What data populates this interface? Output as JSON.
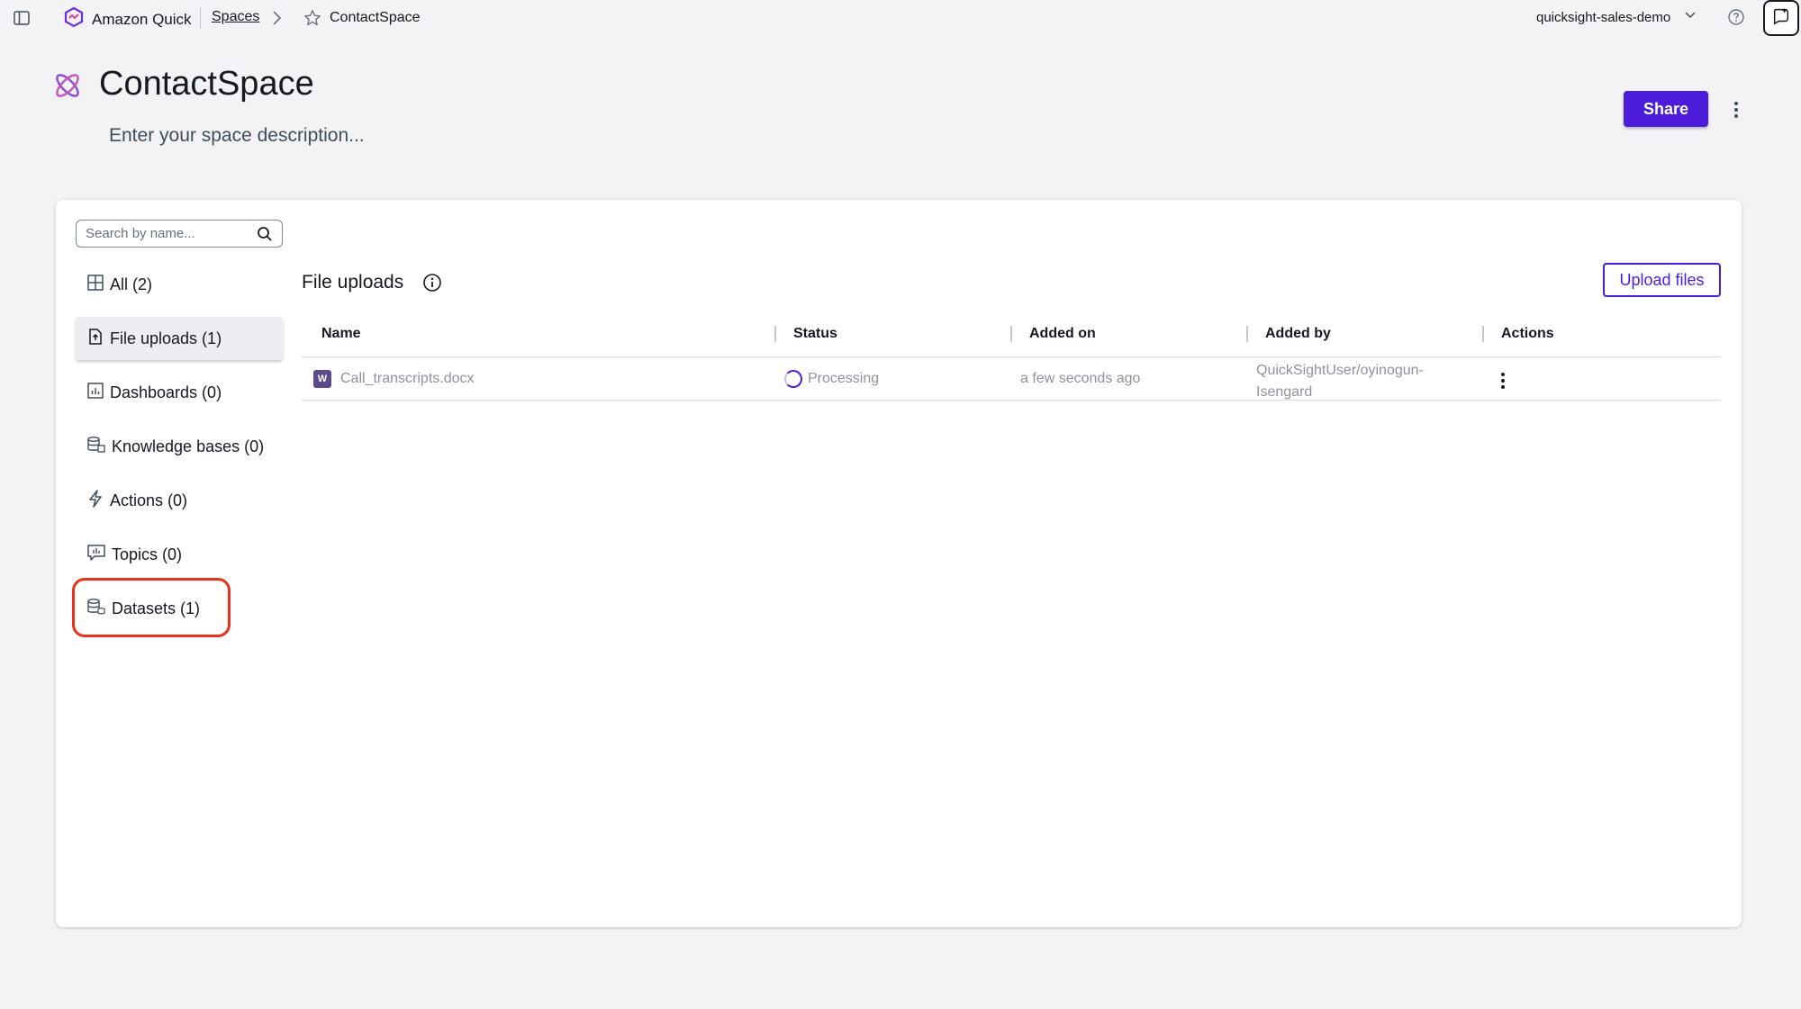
{
  "topbar": {
    "brand_name": "Amazon Quick",
    "breadcrumb_spaces": "Spaces",
    "breadcrumb_current": "ContactSpace",
    "account_name": "quicksight-sales-demo"
  },
  "header": {
    "title": "ContactSpace",
    "description_placeholder": "Enter your space description...",
    "share_label": "Share"
  },
  "sidebar": {
    "search_placeholder": "Search by name...",
    "items": [
      {
        "label": "All (2)",
        "icon": "grid-icon"
      },
      {
        "label": "File uploads (1)",
        "icon": "file-upload-icon",
        "active": true
      },
      {
        "label": "Dashboards (0)",
        "icon": "dashboard-icon"
      },
      {
        "label": "Knowledge bases (0)",
        "icon": "database-icon"
      },
      {
        "label": "Actions (0)",
        "icon": "lightning-icon"
      },
      {
        "label": "Topics (0)",
        "icon": "topic-icon"
      },
      {
        "label": "Datasets (1)",
        "icon": "dataset-icon",
        "highlighted": true
      }
    ]
  },
  "main": {
    "section_title": "File uploads",
    "upload_label": "Upload files",
    "table": {
      "columns": [
        "Name",
        "Status",
        "Added on",
        "Added by",
        "Actions"
      ],
      "rows": [
        {
          "file_type": "W",
          "name": "Call_transcripts.docx",
          "status": "Processing",
          "added_on": "a few seconds ago",
          "added_by_line1": "QuickSightUser/oyinogun-",
          "added_by_line2": "Isengard"
        }
      ]
    }
  },
  "colors": {
    "accent": "#4b1ddb",
    "highlight_ring": "#e8321c",
    "background": "#f3f3f6"
  }
}
